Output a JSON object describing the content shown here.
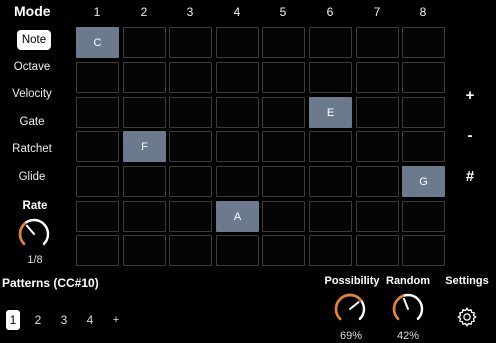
{
  "mode": {
    "title": "Mode",
    "items": [
      "Note",
      "Octave",
      "Velocity",
      "Gate",
      "Ratchet",
      "Glide"
    ],
    "active": "Note"
  },
  "columns": [
    "1",
    "2",
    "3",
    "4",
    "5",
    "6",
    "7",
    "8"
  ],
  "grid": {
    "rows": 7,
    "cols": 8,
    "active_color": "#6c7a8e",
    "cells": [
      {
        "row": 1,
        "col": 1,
        "label": "C"
      },
      {
        "row": 5,
        "col": 4,
        "label": "F"
      },
      {
        "row": 6,
        "col": 3,
        "label": "E"
      },
      {
        "row": 4,
        "col": 6,
        "label": "A"
      },
      {
        "row": 8,
        "col": 5,
        "label": "G"
      }
    ]
  },
  "side_buttons": [
    "+",
    "-",
    "#"
  ],
  "rate": {
    "label": "Rate",
    "value": "1/8",
    "level": 0.35
  },
  "patterns": {
    "title": "Patterns (CC#10)",
    "items": [
      "1",
      "2",
      "3",
      "4"
    ],
    "add": "+",
    "active": "1"
  },
  "possibility": {
    "label": "Possibility",
    "value": "69%",
    "level": 0.69
  },
  "random": {
    "label": "Random",
    "value": "42%",
    "level": 0.42
  },
  "settings": {
    "label": "Settings",
    "icon": "gear-icon"
  },
  "accent_color": "#e8832a"
}
